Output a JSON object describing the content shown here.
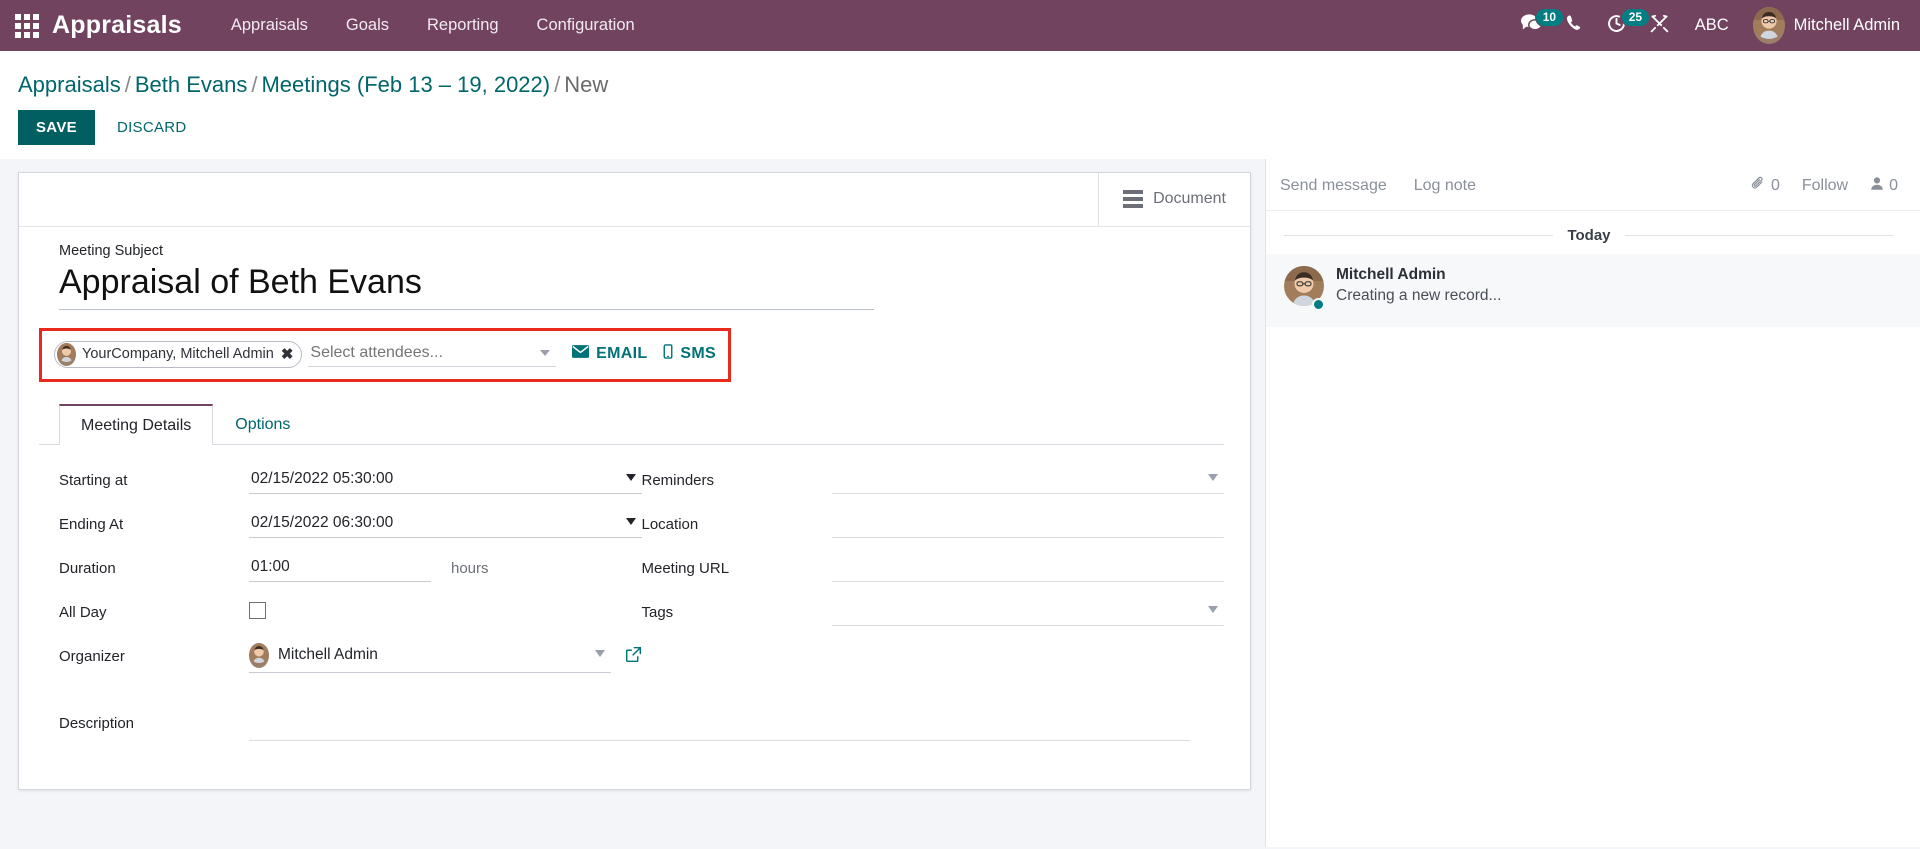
{
  "navbar": {
    "apps_icon": "apps-grid-icon",
    "brand": "Appraisals",
    "menu": [
      {
        "label": "Appraisals"
      },
      {
        "label": "Goals"
      },
      {
        "label": "Reporting"
      },
      {
        "label": "Configuration"
      }
    ],
    "systray": {
      "messages_icon": "comments-icon",
      "messages_count": "10",
      "phone_icon": "phone-icon",
      "activities_icon": "clock-icon",
      "activities_count": "25",
      "debug_icon": "wrench-icon",
      "language": "ABC",
      "user_name": "Mitchell Admin"
    },
    "brand_color": "#71435f",
    "badge_color": "#017e84"
  },
  "control_panel": {
    "breadcrumb": [
      {
        "label": "Appraisals",
        "current": false
      },
      {
        "label": "Beth Evans",
        "current": false
      },
      {
        "label": "Meetings (Feb 13 – 19, 2022)",
        "current": false
      },
      {
        "label": "New",
        "current": true
      }
    ],
    "separator": "/",
    "save_label": "SAVE",
    "discard_label": "DISCARD",
    "save_color": "#015e61"
  },
  "form": {
    "stat_button": {
      "label": "Document",
      "icon": "list-lines-icon"
    },
    "subject": {
      "label": "Meeting Subject",
      "value": "Appraisal of Beth Evans"
    },
    "attendees": {
      "highlight_color": "#e8291c",
      "tag": {
        "label": "YourCompany, Mitchell Admin",
        "remove_icon": "close-icon"
      },
      "placeholder": "Select attendees...",
      "email_button": {
        "label": "EMAIL",
        "icon": "envelope-icon"
      },
      "sms_button": {
        "label": "SMS",
        "icon": "mobile-icon"
      }
    },
    "tabs": [
      {
        "label": "Meeting Details",
        "active": true
      },
      {
        "label": "Options",
        "active": false
      }
    ],
    "left_fields": [
      {
        "label": "Starting at",
        "value": "02/15/2022 05:30:00",
        "type": "datetime"
      },
      {
        "label": "Ending At",
        "value": "02/15/2022 06:30:00",
        "type": "datetime"
      },
      {
        "label": "Duration",
        "value": "01:00",
        "suffix": "hours",
        "type": "short"
      },
      {
        "label": "All Day",
        "value": "",
        "type": "checkbox",
        "checked": false
      },
      {
        "label": "Organizer",
        "value": "Mitchell Admin",
        "type": "many2one"
      }
    ],
    "right_fields": [
      {
        "label": "Reminders",
        "value": "",
        "type": "many2many"
      },
      {
        "label": "Location",
        "value": "",
        "type": "text"
      },
      {
        "label": "Meeting URL",
        "value": "",
        "type": "text"
      },
      {
        "label": "Tags",
        "value": "",
        "type": "many2many"
      }
    ],
    "description": {
      "label": "Description",
      "value": ""
    }
  },
  "chatter": {
    "send_message": "Send message",
    "log_note": "Log note",
    "attachment_icon": "paperclip-icon",
    "attachment_count": "0",
    "follow_label": "Follow",
    "followers_icon": "user-icon",
    "followers_count": "0",
    "day_separator": "Today",
    "messages": [
      {
        "author": "Mitchell Admin",
        "body": "Creating a new record..."
      }
    ]
  }
}
